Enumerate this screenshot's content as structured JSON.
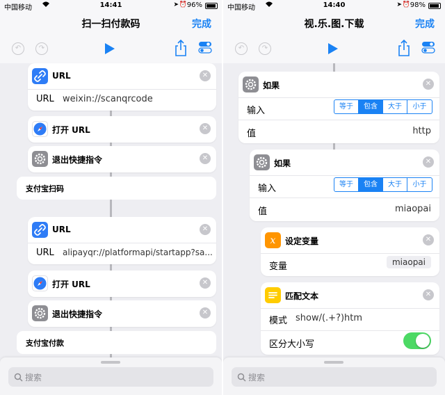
{
  "left": {
    "status": {
      "carrier": "中国移动",
      "time": "14:41",
      "battery": "96%"
    },
    "nav": {
      "title": "扫一扫付款码",
      "done": "完成"
    },
    "actions": [
      {
        "title": "URL",
        "row_label": "URL",
        "row_value": "weixin://scanqrcode"
      },
      {
        "title": "打开 URL"
      },
      {
        "title": "退出快捷指令"
      },
      {
        "label": "支付宝扫码"
      },
      {
        "title": "URL",
        "row_label": "URL",
        "row_value": "alipayqr://platformapi/startapp?sa..."
      },
      {
        "title": "打开 URL"
      },
      {
        "title": "退出快捷指令"
      },
      {
        "label": "支付宝付款"
      }
    ],
    "search": {
      "placeholder": "搜索"
    }
  },
  "right": {
    "status": {
      "carrier": "中国移动",
      "time": "14:40",
      "battery": "98%"
    },
    "nav": {
      "title": "视.乐.图.下载",
      "done": "完成"
    },
    "if1": {
      "title": "如果",
      "input_label": "输入",
      "value_label": "值",
      "value": "http",
      "options": [
        "等于",
        "包含",
        "大于",
        "小于"
      ],
      "selected": "包含"
    },
    "if2": {
      "title": "如果",
      "input_label": "输入",
      "value_label": "值",
      "value": "miaopai",
      "options": [
        "等于",
        "包含",
        "大于",
        "小于"
      ],
      "selected": "包含"
    },
    "setvar": {
      "title": "设定变量",
      "label": "变量",
      "value": "miaopai"
    },
    "match": {
      "title": "匹配文本",
      "pattern_label": "模式",
      "pattern": "show/(.+?)htm",
      "case_label": "区分大小写",
      "case_sensitive": true
    },
    "search": {
      "placeholder": "搜索"
    }
  },
  "colors": {
    "accent": "#1a82f4",
    "toggle_on": "#4cd964",
    "background": "#eeeef2"
  }
}
